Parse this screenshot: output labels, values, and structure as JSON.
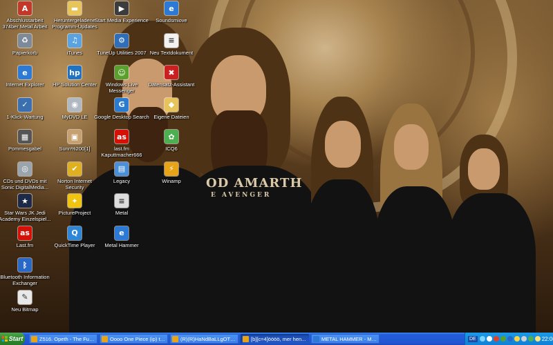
{
  "desktop": {
    "icons": [
      {
        "label": "Abschlussarbeit\n374ber Metal Arbeit",
        "icon": "pdf-document-icon",
        "color": "#c0392b",
        "glyph": "A"
      },
      {
        "label": "Papierkorb",
        "icon": "recycle-bin-icon",
        "color": "#7d8a99",
        "glyph": "♻"
      },
      {
        "label": "Internet Explorer",
        "icon": "internet-explorer-icon",
        "color": "#2d7ad6",
        "glyph": "e"
      },
      {
        "label": "1-Klick-Wartung",
        "icon": "maintenance-tool-icon",
        "color": "#3a6fb0",
        "glyph": "✓"
      },
      {
        "label": "Pommesgabel",
        "icon": "image-file-icon",
        "color": "#555555",
        "glyph": "▦"
      },
      {
        "label": "CDs und DVDs mit\nSonic DigitalMedia...",
        "icon": "cd-dvd-icon",
        "color": "#9aa4ad",
        "glyph": "◎"
      },
      {
        "label": "Star Wars JK Jedi\nAcademy Einzelspiel...",
        "icon": "star-wars-game-icon",
        "color": "#1c2a48",
        "glyph": "★"
      },
      {
        "label": "Last.fm",
        "icon": "lastfm-icon",
        "color": "#d51007",
        "glyph": "as"
      },
      {
        "label": "Bluetooth Information\nExchanger",
        "icon": "bluetooth-icon",
        "color": "#2a68c8",
        "glyph": "ᛒ"
      },
      {
        "label": "Neu Bitmap",
        "icon": "bitmap-file-icon",
        "color": "#e8e8e8",
        "glyph": "✎"
      },
      {
        "label": "Heruntergeladene\nProgramm-Updates",
        "icon": "folder-icon",
        "color": "#e8c55a",
        "glyph": "▬"
      },
      {
        "label": "iTunes",
        "icon": "itunes-icon",
        "color": "#5ba3e0",
        "glyph": "♫"
      },
      {
        "label": "HP Solution Center",
        "icon": "hp-solution-center-icon",
        "color": "#1f73c4",
        "glyph": "hp"
      },
      {
        "label": "MyDVD LE",
        "icon": "mydvd-icon",
        "color": "#b0b8c2",
        "glyph": "◉"
      },
      {
        "label": "Sunn%200[1]",
        "icon": "image-file-icon",
        "color": "#c6a070",
        "glyph": "▣"
      },
      {
        "label": "Norton Internet\nSecurity",
        "icon": "norton-security-icon",
        "color": "#e0b020",
        "glyph": "✔"
      },
      {
        "label": "PictureProject",
        "icon": "pictureproject-icon",
        "color": "#f1c40f",
        "glyph": "✦"
      },
      {
        "label": "QuickTime Player",
        "icon": "quicktime-icon",
        "color": "#2d86d8",
        "glyph": "Q"
      },
      {
        "label": "Start Media Experience",
        "icon": "media-experience-icon",
        "color": "#3c3c3c",
        "glyph": "▶"
      },
      {
        "label": "TuneUp Utilities 2007",
        "icon": "tuneup-utilities-icon",
        "color": "#2f6fba",
        "glyph": "⚙"
      },
      {
        "label": "Windows Live\nMessenger",
        "icon": "messenger-icon",
        "color": "#5aa02c",
        "glyph": "☺"
      },
      {
        "label": "Google Desktop Search",
        "icon": "google-desktop-icon",
        "color": "#2b7bd0",
        "glyph": "G"
      },
      {
        "label": "last.fm\nKaputtmacher666",
        "icon": "lastfm-icon",
        "color": "#d51007",
        "glyph": "as"
      },
      {
        "label": "Legacy",
        "icon": "folder-icon",
        "color": "#4a8fd8",
        "glyph": "▤"
      },
      {
        "label": "Metal",
        "icon": "text-document-icon",
        "color": "#dcdcdc",
        "glyph": "≡"
      },
      {
        "label": "Metal Hammer",
        "icon": "internet-shortcut-icon",
        "color": "#2d7ad6",
        "glyph": "e"
      },
      {
        "label": "Soundsmiove",
        "icon": "internet-shortcut-icon",
        "color": "#2d7ad6",
        "glyph": "e"
      },
      {
        "label": "Neu Textdokument",
        "icon": "text-document-icon",
        "color": "#f2f2f2",
        "glyph": "≡"
      },
      {
        "label": "Datensatz-Assistant",
        "icon": "assistant-icon",
        "color": "#cc2020",
        "glyph": "✖"
      },
      {
        "label": "Eigene Dateien",
        "icon": "my-documents-icon",
        "color": "#e6c45b",
        "glyph": "◆"
      },
      {
        "label": "ICQ6",
        "icon": "icq-icon",
        "color": "#4caf50",
        "glyph": "✿"
      },
      {
        "label": "Winamp",
        "icon": "winamp-icon",
        "color": "#e8a317",
        "glyph": "⚡"
      }
    ]
  },
  "shirt_text": {
    "line1": "OD AMARTH",
    "line2": "E AVENGER"
  },
  "taskbar": {
    "start_label": "Start",
    "tasks": [
      {
        "label": "Z516. Opeth - The Funer...",
        "color": "#e8a317",
        "active": false
      },
      {
        "label": "Oooo One Piece (ip) tata...",
        "color": "#e8a317",
        "active": false
      },
      {
        "label": "(R)(R)HaNdBaLLgOTt(R)...",
        "color": "#e8a317",
        "active": false
      },
      {
        "label": "[b][c=4]öööö, mer hen...",
        "color": "#e8a317",
        "active": true
      },
      {
        "label": "METAL HAMMER - MAXI...",
        "color": "#2d7ad6",
        "active": false
      }
    ],
    "tray": {
      "language": "DE",
      "icons": [
        "network-icon",
        "volume-icon",
        "security-icon",
        "messenger-tray-icon",
        "bluetooth-tray-icon",
        "update-icon",
        "antivirus-icon",
        "icq-tray-icon",
        "power-icon"
      ],
      "clock": "22:06"
    }
  }
}
